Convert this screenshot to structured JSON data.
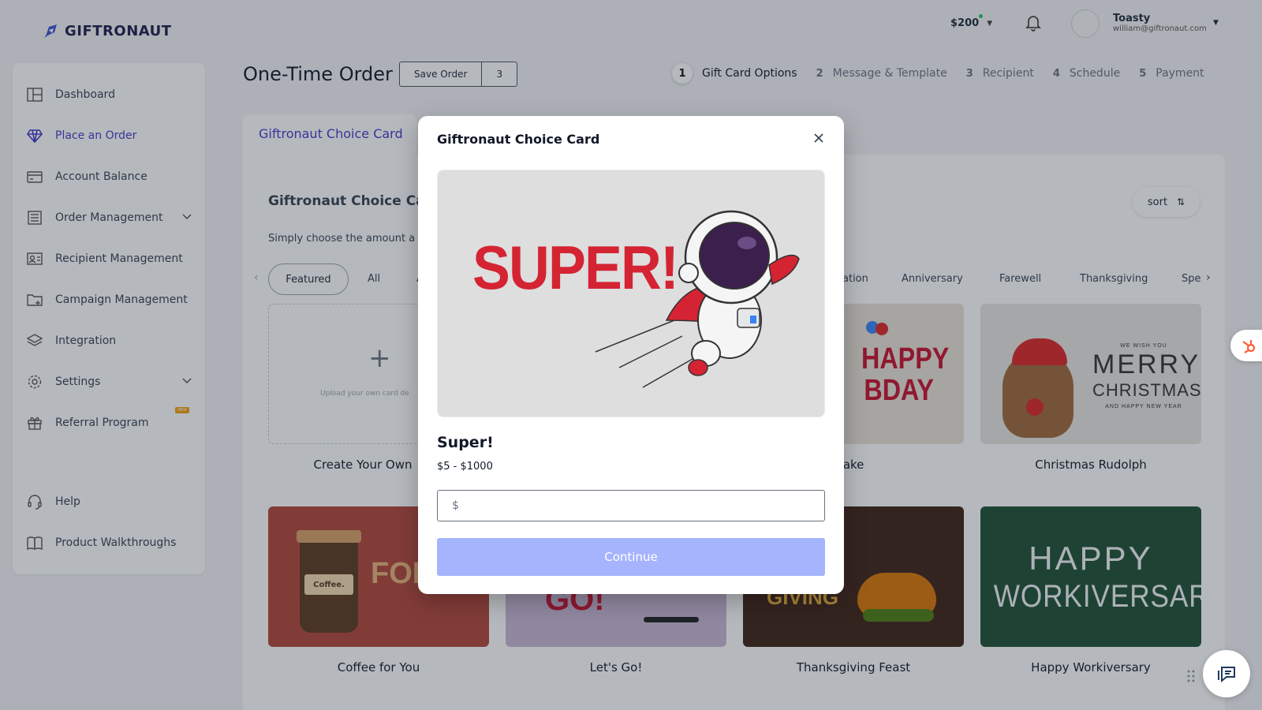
{
  "brand": {
    "name": "GIFTRONAUT"
  },
  "header": {
    "balance": "$200",
    "user_name": "Toasty",
    "user_email": "william@giftronaut.com"
  },
  "sidebar": {
    "items": [
      {
        "label": "Dashboard",
        "icon": "dashboard-icon"
      },
      {
        "label": "Place an Order",
        "icon": "diamond-icon",
        "active": true
      },
      {
        "label": "Account Balance",
        "icon": "credit-card-icon"
      },
      {
        "label": "Order Management",
        "icon": "list-icon",
        "expandable": true
      },
      {
        "label": "Recipient Management",
        "icon": "contact-card-icon"
      },
      {
        "label": "Campaign Management",
        "icon": "folder-plus-icon"
      },
      {
        "label": "Integration",
        "icon": "layers-icon"
      },
      {
        "label": "Settings",
        "icon": "gear-icon",
        "expandable": true
      },
      {
        "label": "Referral Program",
        "icon": "gift-icon",
        "badge": "NEW"
      },
      {
        "label": "Help",
        "icon": "headset-icon"
      },
      {
        "label": "Product Walkthroughs",
        "icon": "book-icon"
      }
    ]
  },
  "page": {
    "title": "One-Time Order",
    "save_label": "Save Order",
    "save_count": "3"
  },
  "steps": [
    {
      "num": "1",
      "label": "Gift Card Options"
    },
    {
      "num": "2",
      "label": "Message & Template"
    },
    {
      "num": "3",
      "label": "Recipient"
    },
    {
      "num": "4",
      "label": "Schedule"
    },
    {
      "num": "5",
      "label": "Payment"
    }
  ],
  "main": {
    "tab": "Giftronaut Choice Card",
    "title": "Giftronaut Choice Car",
    "subtitle": "Simply choose the amount a",
    "sort_label": "sort",
    "categories": {
      "featured": "Featured",
      "all": "All",
      "partial_a": "A",
      "graduation": "ation",
      "anniversary": "Anniversary",
      "farewell": "Farewell",
      "thanksgiving": "Thanksgiving",
      "special": "Spe"
    },
    "upload_text": "Upload your own card de",
    "cards": [
      {
        "title": "Create Your Own"
      },
      {
        "title": "day Cake"
      },
      {
        "title": "Christmas Rudolph"
      },
      {
        "title": "Coffee for You"
      },
      {
        "title": "Let's Go!"
      },
      {
        "title": "Thanksgiving Feast"
      },
      {
        "title": "Happy Workiversary"
      }
    ],
    "card_art": {
      "bday_l1": "HAPPY",
      "bday_l2": "BDAY",
      "xmas_top": "WE WISH YOU",
      "xmas_l1": "MERRY",
      "xmas_l2": "CHRISTMAS",
      "xmas_bottom": "AND HAPPY NEW YEAR",
      "coffee_cup": "Coffee.",
      "coffee_for": "FOR",
      "letsgo": "GO!",
      "thanks": "GIVING",
      "work_l1": "HAPPY",
      "work_l2": "WORKIVERSARY!"
    }
  },
  "modal": {
    "title": "Giftronaut Choice Card",
    "art_text": "SUPER!",
    "card_name": "Super!",
    "range": "$5 - $1000",
    "amount_placeholder": "$",
    "continue_label": "Continue"
  },
  "colors": {
    "accent": "#4338ca",
    "continue_disabled": "#a5b4fc",
    "super_red": "#d42433"
  }
}
